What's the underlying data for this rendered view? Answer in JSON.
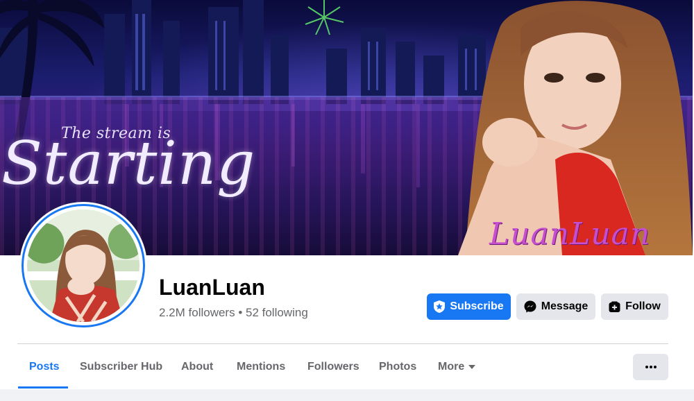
{
  "cover": {
    "text_small": "The stream is",
    "text_big": "Starting",
    "watermark": "LuanLuan"
  },
  "profile": {
    "name": "LuanLuan",
    "followers_line": "2.2M followers • 52 following"
  },
  "actions": {
    "subscribe_label": "Subscribe",
    "message_label": "Message",
    "follow_label": "Follow"
  },
  "tabs": [
    {
      "label": "Posts",
      "active": true
    },
    {
      "label": "Subscriber Hub"
    },
    {
      "label": "About"
    },
    {
      "label": "Mentions"
    },
    {
      "label": "Followers"
    },
    {
      "label": "Photos"
    },
    {
      "label": "More"
    }
  ],
  "icons": {
    "subscribe": "shield-star-icon",
    "message": "messenger-icon",
    "follow": "follow-plus-icon",
    "more": "chevron-down-icon",
    "overflow": "more-dots-icon"
  },
  "colors": {
    "accent": "#1877f2",
    "button_gray": "#e4e6eb",
    "text_primary": "#050505",
    "text_secondary": "#65676b"
  }
}
